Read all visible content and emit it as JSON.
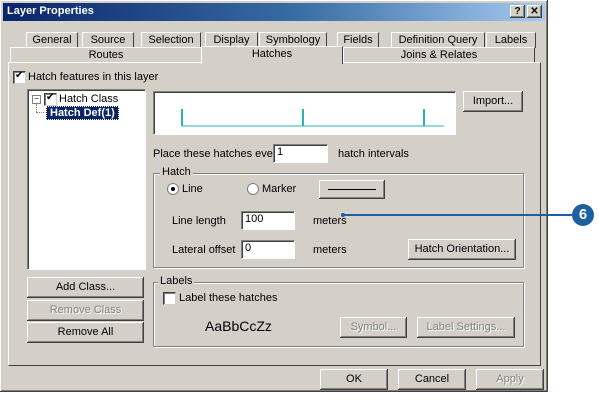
{
  "window": {
    "title": "Layer Properties",
    "help_btn": "?",
    "close_btn": "✕"
  },
  "tabs": {
    "row1": [
      "General",
      "Source",
      "Selection",
      "Display",
      "Symbology",
      "Fields",
      "Definition Query",
      "Labels"
    ],
    "row2": [
      "Routes",
      "Hatches",
      "Joins & Relates"
    ],
    "active": "Hatches"
  },
  "hatch_features_label": "Hatch features in this layer",
  "tree": {
    "root_label": "Hatch Class",
    "child_label": "Hatch Def(1)"
  },
  "buttons": {
    "import": "Import...",
    "add_class": "Add Class...",
    "remove_class": "Remove Class",
    "remove_all": "Remove All",
    "hatch_orientation": "Hatch Orientation...",
    "symbol": "Symbol...",
    "label_settings": "Label Settings...",
    "ok": "OK",
    "cancel": "Cancel",
    "apply": "Apply"
  },
  "interval": {
    "prefix": "Place these hatches every",
    "value": "1",
    "suffix": "hatch intervals"
  },
  "hatch_group": {
    "title": "Hatch",
    "line_label": "Line",
    "marker_label": "Marker",
    "line_length_label": "Line length",
    "line_length_value": "100",
    "line_length_unit": "meters",
    "lateral_offset_label": "Lateral offset",
    "lateral_offset_value": "0",
    "lateral_offset_unit": "meters"
  },
  "labels_group": {
    "title": "Labels",
    "checkbox_label": "Label these hatches",
    "sample_text": "AaBbCcZz"
  },
  "callout": {
    "number": "6",
    "color": "#1e5fa0"
  },
  "colors": {
    "hatch_preview": "#2ab5b5",
    "selection": "#0a246a"
  }
}
